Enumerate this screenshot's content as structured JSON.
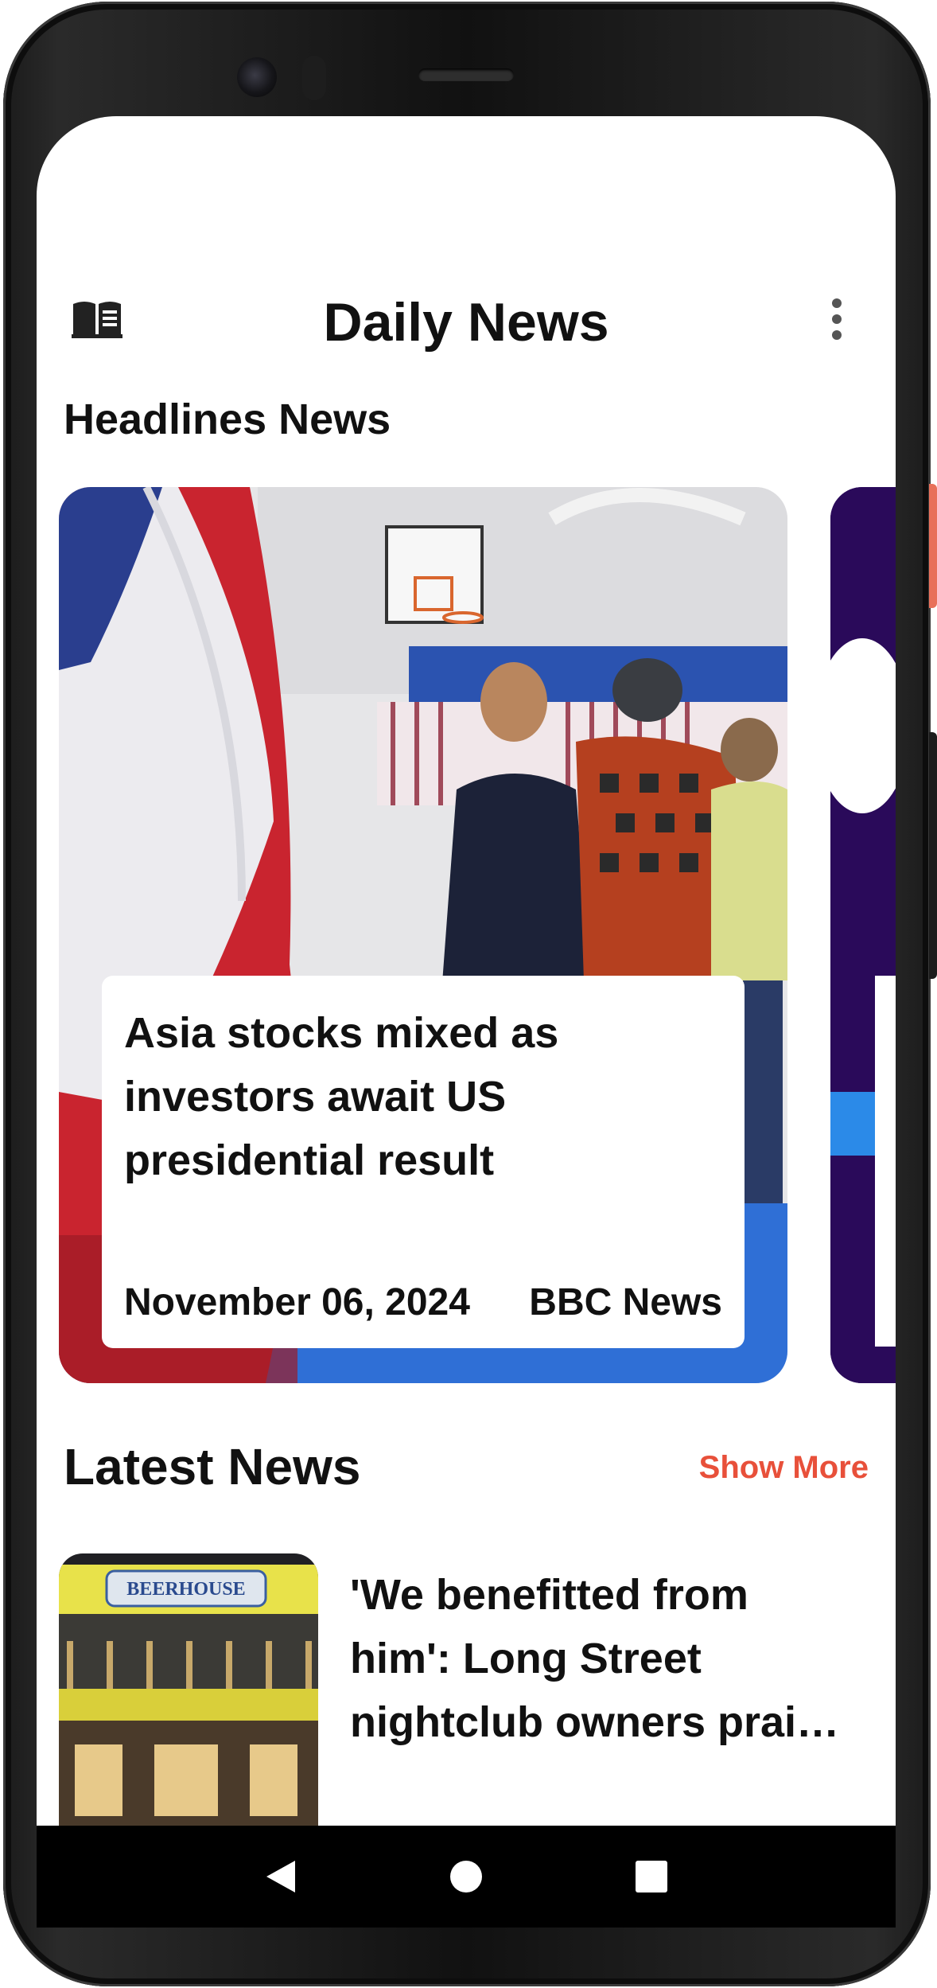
{
  "app": {
    "title": "Daily News"
  },
  "headlines": {
    "section_title": "Headlines News",
    "cards": [
      {
        "title": "Asia stocks mixed as investors await US presidential result",
        "date": "November 06, 2024",
        "source": "BBC News"
      }
    ]
  },
  "latest": {
    "section_title": "Latest News",
    "show_more": "Show More",
    "items": [
      {
        "title_lines": [
          "'We benefitted from",
          "him': Long Street",
          "nightclub owners prai…"
        ],
        "thumb_sign": "BEERHOUSE"
      }
    ]
  },
  "colors": {
    "accent": "#e8503a",
    "next_card": "#2a0a5a"
  },
  "icons": {
    "app": "book-icon",
    "menu": "more-vert-icon",
    "nav": [
      "back-icon",
      "home-icon",
      "recents-icon"
    ]
  }
}
